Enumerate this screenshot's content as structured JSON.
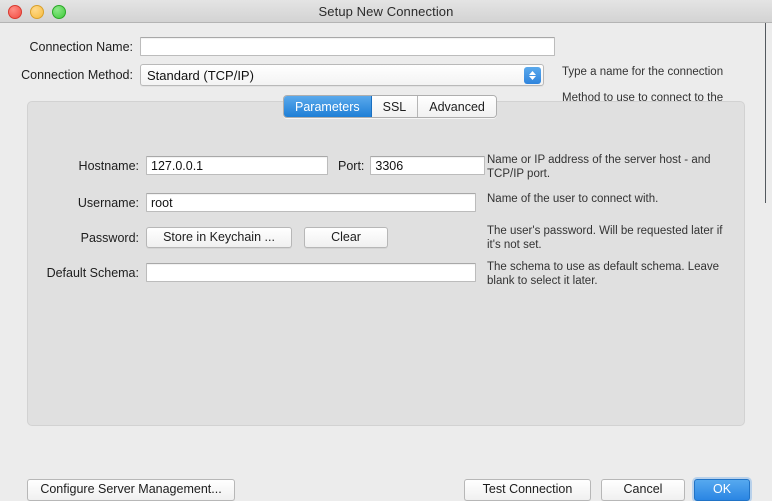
{
  "window": {
    "title": "Setup New Connection",
    "traffic_lights": [
      "close-button",
      "minimize-button",
      "zoom-button"
    ]
  },
  "form": {
    "connection_name": {
      "label": "Connection Name:",
      "value": "",
      "hint": "Type a name for the connection"
    },
    "connection_method": {
      "label": "Connection Method:",
      "value": "Standard (TCP/IP)",
      "hint": "Method to use to connect to the RDBMS",
      "options": [
        "Standard (TCP/IP)"
      ]
    }
  },
  "tabs": [
    {
      "label": "Parameters",
      "active": true
    },
    {
      "label": "SSL",
      "active": false
    },
    {
      "label": "Advanced",
      "active": false
    }
  ],
  "parameters": {
    "hostname": {
      "label": "Hostname:",
      "value": "127.0.0.1",
      "hint": "Name or IP address of the server host - and TCP/IP port."
    },
    "port": {
      "label": "Port:",
      "value": "3306"
    },
    "username": {
      "label": "Username:",
      "value": "root",
      "hint": "Name of the user to connect with."
    },
    "password": {
      "label": "Password:",
      "store_button": "Store in Keychain ...",
      "clear_button": "Clear",
      "hint": "The user's password. Will be requested later if it's not set."
    },
    "default_schema": {
      "label": "Default Schema:",
      "value": "",
      "hint": "The schema to use as default schema. Leave blank to select it later."
    }
  },
  "footer": {
    "configure": "Configure Server Management...",
    "test": "Test Connection",
    "cancel": "Cancel",
    "ok": "OK"
  },
  "colors": {
    "accent_blue": "#2a85e3",
    "tab_active_blue": "#1f7fd6",
    "window_bg": "#ececec",
    "panel_bg": "#e0e0e0"
  }
}
